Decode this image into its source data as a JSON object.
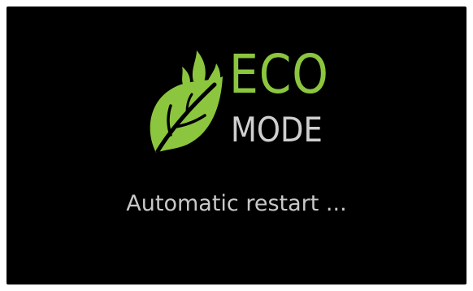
{
  "logo": {
    "icon": "eco-leaf-flame-icon",
    "title": "ECO",
    "subtitle": "MODE"
  },
  "status": {
    "message": "Automatic restart ..."
  },
  "colors": {
    "background": "#000000",
    "accent_green": "#8cc63f",
    "text_gray": "#c8c8c8"
  }
}
